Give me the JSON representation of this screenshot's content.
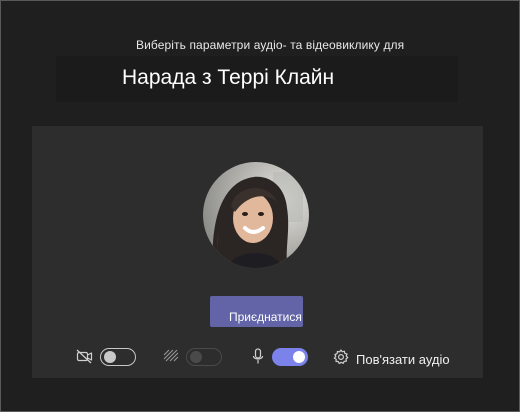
{
  "header": {
    "subtitle": "Виберіть параметри аудіо- та відеовиклику для",
    "meeting_title": "Нарада з Террі Клайн"
  },
  "prejoin": {
    "join_label": "Приєднатися",
    "controls": {
      "camera": {
        "icon": "camera-off-icon",
        "state": "off"
      },
      "background_effects": {
        "icon": "background-blur-icon",
        "state": "disabled"
      },
      "microphone": {
        "icon": "microphone-icon",
        "state": "on"
      },
      "device_settings": {
        "icon": "gear-icon",
        "label": "Пов'язати аудіо"
      }
    }
  },
  "colors": {
    "accent": "#6264a7",
    "toggle_on": "#7b83eb",
    "background": "#1f1f1f",
    "card": "#2d2d2d"
  }
}
